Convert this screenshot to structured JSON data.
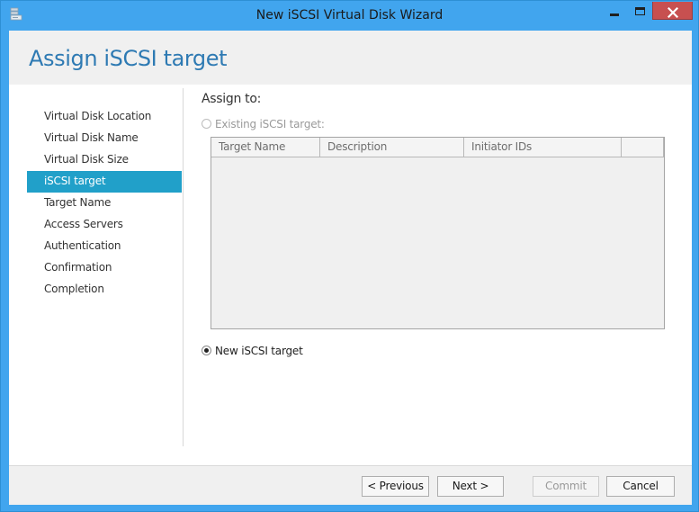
{
  "window": {
    "title": "New iSCSI Virtual Disk Wizard",
    "accent_color": "#41a5ee",
    "close_color": "#c75050"
  },
  "page": {
    "title": "Assign iSCSI target",
    "title_color": "#2e7ab3"
  },
  "nav": {
    "items": [
      {
        "label": "Virtual Disk Location",
        "active": false
      },
      {
        "label": "Virtual Disk Name",
        "active": false
      },
      {
        "label": "Virtual Disk Size",
        "active": false
      },
      {
        "label": "iSCSI target",
        "active": true
      },
      {
        "label": "Target Name",
        "active": false
      },
      {
        "label": "Access Servers",
        "active": false
      },
      {
        "label": "Authentication",
        "active": false
      },
      {
        "label": "Confirmation",
        "active": false
      },
      {
        "label": "Completion",
        "active": false
      }
    ],
    "active_color": "#21a0c9"
  },
  "assign": {
    "heading": "Assign to:",
    "existing_label": "Existing iSCSI target:",
    "existing_selected": false,
    "existing_enabled": false,
    "new_label": "New iSCSI target",
    "new_selected": true
  },
  "targets_table": {
    "columns": [
      "Target Name",
      "Description",
      "Initiator IDs",
      ""
    ],
    "rows": []
  },
  "buttons": {
    "previous": "< Previous",
    "next": "Next >",
    "commit": "Commit",
    "cancel": "Cancel",
    "commit_enabled": false
  },
  "icons": {
    "app": "wizard-app-icon",
    "minimize": "minimize-icon",
    "maximize": "maximize-icon",
    "close": "close-icon"
  }
}
